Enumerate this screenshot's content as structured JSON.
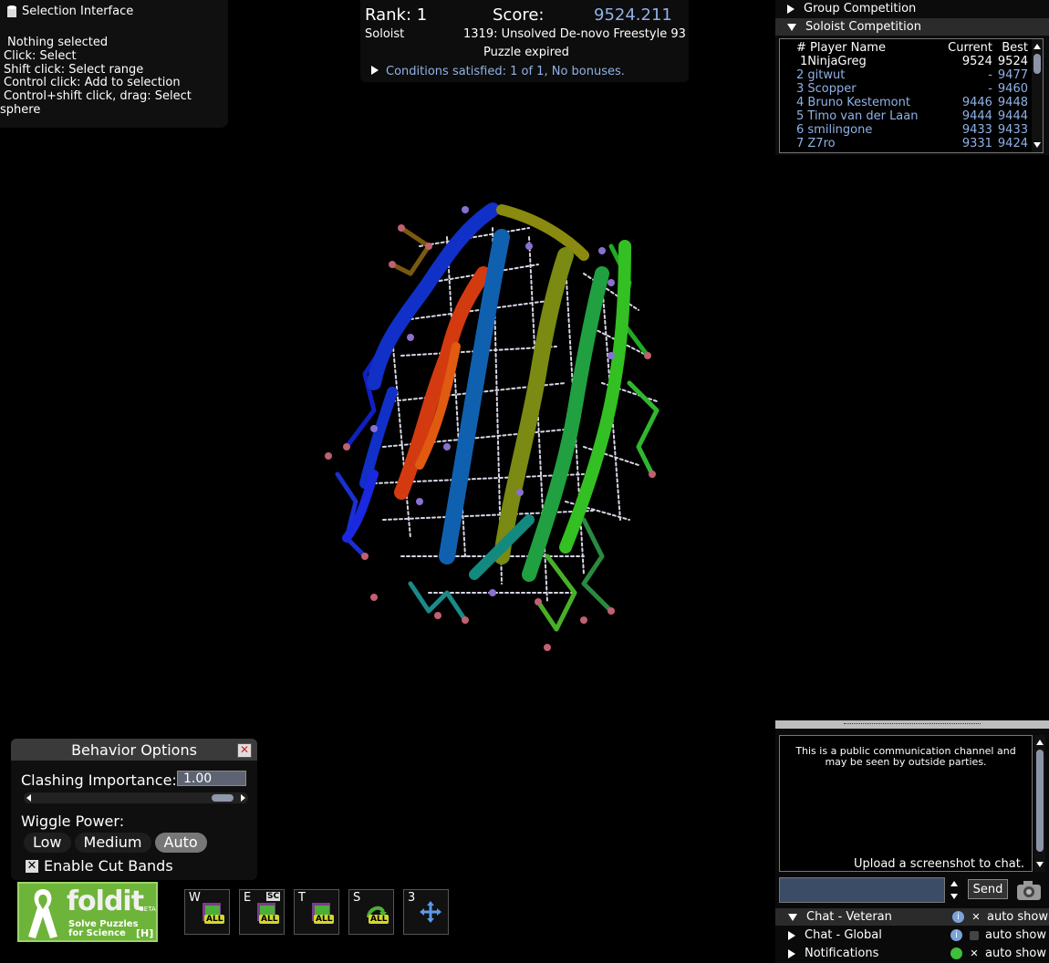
{
  "selection_panel": {
    "title": "Selection Interface",
    "lines": [
      " Nothing selected",
      " Click: Select",
      " Shift click: Select range",
      " Control click: Add to selection",
      " Control+shift click, drag: Select",
      "sphere"
    ]
  },
  "score_panel": {
    "rank": "Rank: 1",
    "score_label": "Score:",
    "score_value": "9524.211",
    "mode": "Soloist",
    "puzzle": "1319: Unsolved De-novo Freestyle 93",
    "status": "Puzzle expired",
    "conditions": "Conditions satisfied: 1 of 1, No bonuses."
  },
  "competition": {
    "group_label": "Group Competition",
    "soloist_label": "Soloist Competition",
    "headers": [
      "# Player Name",
      "Current",
      "Best"
    ],
    "rows": [
      {
        "name": "1NinjaGreg",
        "current": "9524",
        "best": "9524"
      },
      {
        "name": "2 gitwut",
        "current": "-",
        "best": "9477"
      },
      {
        "name": "3 Scopper",
        "current": "-",
        "best": "9460"
      },
      {
        "name": "4 Bruno Kestemont",
        "current": "9446",
        "best": "9448"
      },
      {
        "name": "5 Timo van der Laan",
        "current": "9444",
        "best": "9444"
      },
      {
        "name": "6 smilingone",
        "current": "9433",
        "best": "9433"
      },
      {
        "name": "7 Z7ro",
        "current": "9331",
        "best": "9424"
      }
    ]
  },
  "behavior": {
    "title": "Behavior Options",
    "clashing_label": "Clashing Importance:",
    "clashing_value": "1.00",
    "clashing_slider_fraction": 1.0,
    "wiggle_label": "Wiggle Power:",
    "wiggle_options": [
      "Low",
      "Medium",
      "Auto"
    ],
    "wiggle_selected": "Auto",
    "cut_bands_label": "Enable Cut Bands",
    "cut_bands_checked": true
  },
  "logo": {
    "name": "foldit",
    "beta": "BETA",
    "tagline_1": "Solve Puzzles",
    "tagline_2": "for Science",
    "hotkey": "[H]"
  },
  "tools": [
    {
      "key": "W",
      "badge": "ALL",
      "icon": "wiggle-icon"
    },
    {
      "key": "E",
      "badge": "ALL",
      "extra": "SC",
      "icon": "shake-icon"
    },
    {
      "key": "T",
      "badge": "ALL",
      "icon": "tweak-icon"
    },
    {
      "key": "S",
      "badge": "ALL",
      "icon": "rebuild-icon"
    },
    {
      "key": "3",
      "badge": "",
      "icon": "move-icon"
    }
  ],
  "chat": {
    "notice": "This is a public communication channel and may be seen by outside parties.",
    "upload_hint": "Upload a screenshot to chat.",
    "input_value": "",
    "send_label": "Send",
    "channels": [
      {
        "name": "Chat - Veteran",
        "auto_show": "auto show",
        "checked": true,
        "expanded": true
      },
      {
        "name": "Chat - Global",
        "auto_show": "auto show",
        "checked": false,
        "expanded": false
      },
      {
        "name": "Notifications",
        "auto_show": "auto show",
        "checked": true,
        "expanded": false
      }
    ]
  },
  "colors": {
    "accent_blue": "#8fb2e6",
    "logo_green": "#6fb43a",
    "input_bg": "#3b4d66"
  }
}
